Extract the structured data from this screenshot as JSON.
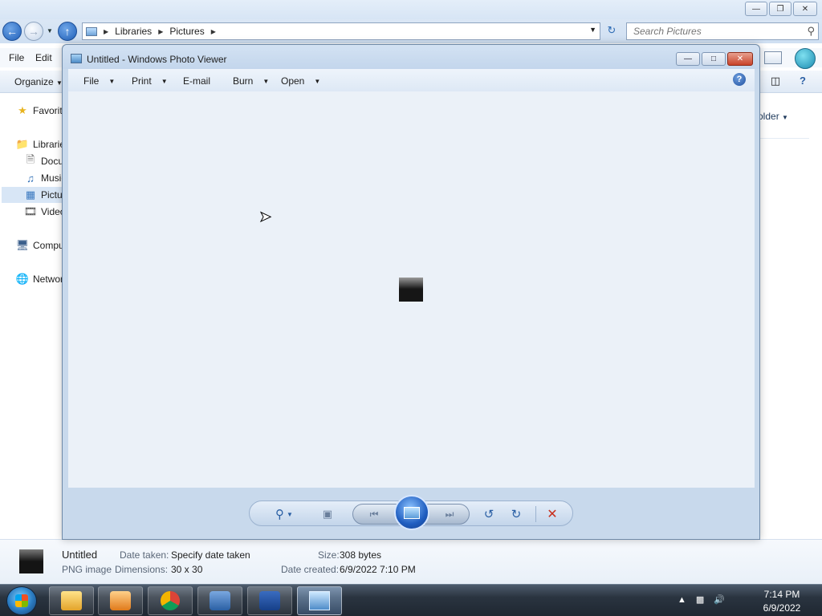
{
  "explorer": {
    "address": {
      "crumbs": [
        "Libraries",
        "Pictures"
      ]
    },
    "search_placeholder": "Search Pictures",
    "menu": {
      "file": "File",
      "edit": "Edit"
    },
    "toolbar": {
      "organize": "Organize",
      "folder_hint": "older"
    },
    "nav": {
      "favorites": "Favorites",
      "libraries": "Libraries",
      "documents": "Documents",
      "music": "Music",
      "pictures": "Pictures",
      "videos": "Videos",
      "computer": "Computer",
      "network": "Network"
    },
    "details": {
      "name": "Untitled",
      "type": "PNG image",
      "date_taken_label": "Date taken:",
      "date_taken_value": "Specify date taken",
      "dimensions_label": "Dimensions:",
      "dimensions_value": "30 x 30",
      "size_label": "Size:",
      "size_value": "308 bytes",
      "date_created_label": "Date created:",
      "date_created_value": "6/9/2022 7:10 PM"
    }
  },
  "viewer": {
    "title": "Untitled - Windows Photo Viewer",
    "menu": {
      "file": "File",
      "print": "Print",
      "email": "E-mail",
      "burn": "Burn",
      "open": "Open"
    }
  },
  "taskbar": {
    "time": "7:14 PM",
    "date": "6/9/2022"
  },
  "colors": {
    "accent": "#1f5fb8",
    "viewer_frame": "#c8d9ec",
    "canvas": "#ebf1f8",
    "close_red": "#c8422a"
  }
}
